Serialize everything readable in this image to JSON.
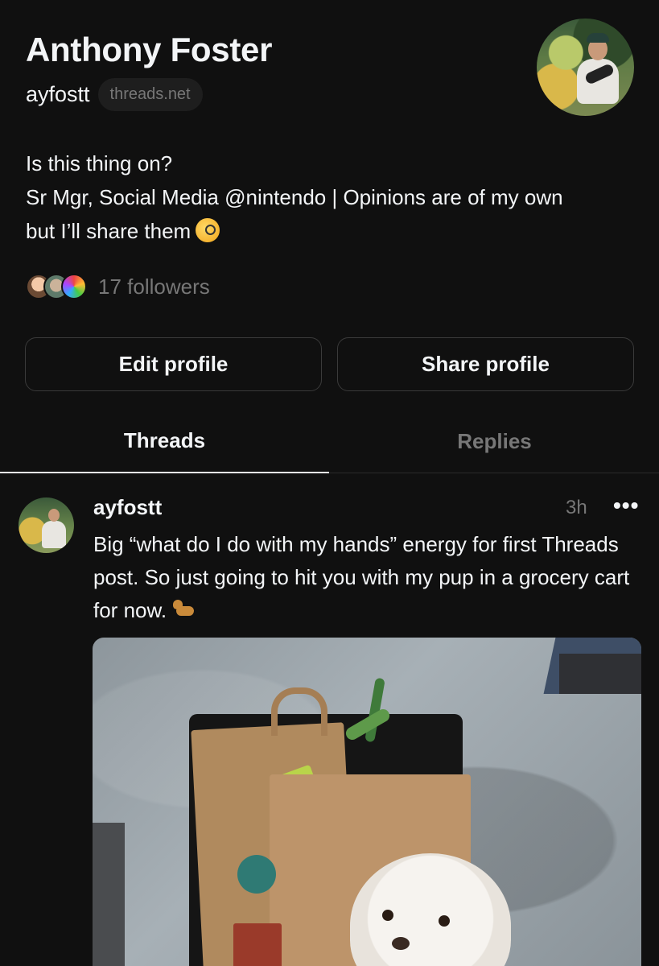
{
  "profile": {
    "name": "Anthony Foster",
    "handle": "ayfostt",
    "domain": "threads.net",
    "bio_lines": [
      "Is this thing on?",
      "Sr Mgr, Social Media @nintendo | Opinions are of my own",
      "but I’ll share them"
    ],
    "followers_text": "17 followers"
  },
  "buttons": {
    "edit": "Edit profile",
    "share": "Share profile"
  },
  "tabs": {
    "threads": "Threads",
    "replies": "Replies"
  },
  "post": {
    "username": "ayfostt",
    "time": "3h",
    "more": "•••",
    "text": "Big “what do I do with my hands” energy for first Threads post. So just going to hit you with my pup in a grocery cart for now."
  },
  "colors": {
    "background": "#101010",
    "text_primary": "#f3f5f7",
    "text_secondary": "#777777",
    "border": "#3a3a3a"
  }
}
